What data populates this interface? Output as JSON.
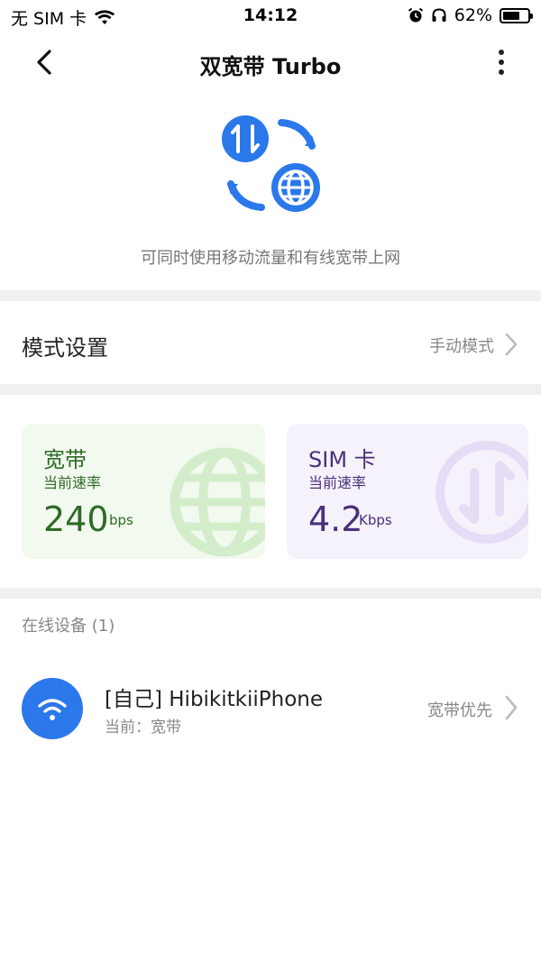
{
  "status_bar": {
    "carrier": "无 SIM 卡",
    "time": "14:12",
    "battery": "62%"
  },
  "nav": {
    "title": "双宽带 Turbo"
  },
  "hero": {
    "description": "可同时使用移动流量和有线宽带上网"
  },
  "mode": {
    "label": "模式设置",
    "value": "手动模式"
  },
  "cards": {
    "broadband": {
      "title": "宽带",
      "subtitle": "当前速率",
      "value": "240",
      "unit": "bps",
      "color": "#2f6b26"
    },
    "sim": {
      "title": "SIM 卡",
      "subtitle": "当前速率",
      "value": "4.2",
      "unit": "Kbps",
      "color": "#4b2f7a"
    }
  },
  "devices": {
    "header": "在线设备 (1)",
    "items": [
      {
        "name": "[自己] HibikitkiiPhone",
        "status": "当前：宽带",
        "preference": "宽带优先"
      }
    ]
  },
  "colors": {
    "accent": "#2a78ea",
    "divider": "#f0f0f0"
  }
}
